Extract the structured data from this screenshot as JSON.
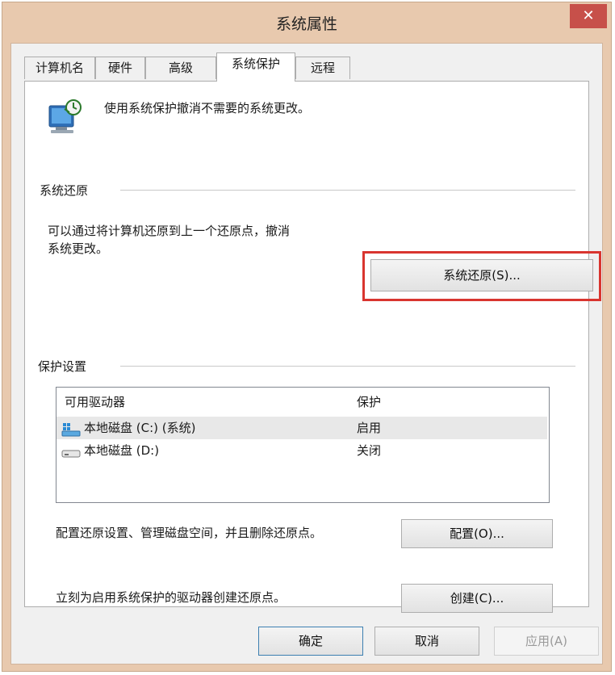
{
  "window": {
    "title": "系统属性",
    "close_glyph": "✕"
  },
  "tabs": [
    {
      "label": "计算机名"
    },
    {
      "label": "硬件"
    },
    {
      "label": "高级"
    },
    {
      "label": "系统保护",
      "active": true
    },
    {
      "label": "远程"
    }
  ],
  "header": {
    "icon": "system-protection-icon",
    "text": "使用系统保护撤消不需要的系统更改。"
  },
  "restore_group": {
    "label": "系统还原",
    "description_line1": "可以通过将计算机还原到上一个还原点，撤消",
    "description_line2": "系统更改。",
    "button_label": "系统还原(S)..."
  },
  "protection_group": {
    "label": "保护设置",
    "columns": [
      "可用驱动器",
      "保护"
    ],
    "drives": [
      {
        "name": "本地磁盘 (C:) (系统)",
        "protection": "启用",
        "icon": "system-drive-icon"
      },
      {
        "name": "本地磁盘 (D:)",
        "protection": "关闭",
        "icon": "drive-icon"
      }
    ],
    "configure_text": "配置还原设置、管理磁盘空间，并且删除还原点。",
    "configure_button": "配置(O)...",
    "create_text": "立刻为启用系统保护的驱动器创建还原点。",
    "create_button": "创建(C)..."
  },
  "footer": {
    "ok": "确定",
    "cancel": "取消",
    "apply": "应用(A)"
  },
  "colors": {
    "frame": "#e8c9ae",
    "highlight": "#d9352f",
    "close": "#c7504a"
  }
}
